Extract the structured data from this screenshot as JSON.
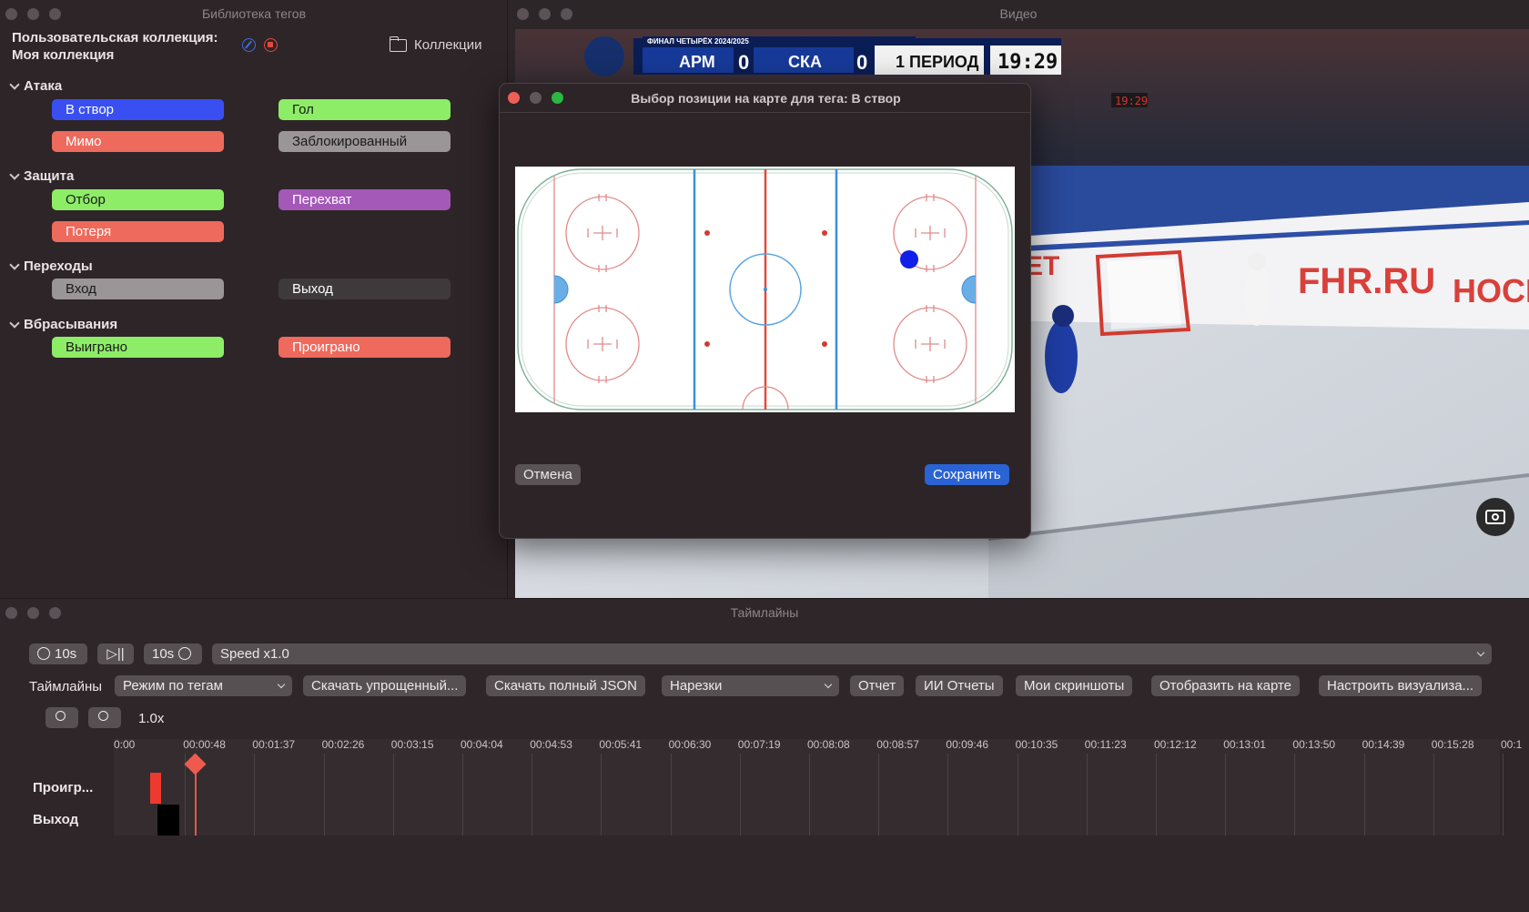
{
  "taglib": {
    "title": "Библиотека тегов",
    "collection_line1": "Пользовательская коллекция:",
    "collection_line2": "Моя коллекция",
    "collections_button": "Коллекции",
    "categories": [
      {
        "name": "Атака",
        "tags": [
          {
            "label": "В створ",
            "color": "#3a4ff2"
          },
          {
            "label": "Гол",
            "color": "#8ded67"
          },
          {
            "label": "Мимо",
            "color": "#ee6a5c"
          },
          {
            "label": "Заблокированный",
            "color": "#9a9597"
          }
        ]
      },
      {
        "name": "Защита",
        "tags": [
          {
            "label": "Отбор",
            "color": "#8ded67"
          },
          {
            "label": "Перехват",
            "color": "#a458b8"
          },
          {
            "label": "Потеря",
            "color": "#ee6a5c"
          }
        ]
      },
      {
        "name": "Переходы",
        "tags": [
          {
            "label": "Вход",
            "color": "#9a9597"
          },
          {
            "label": "Выход",
            "color": "#3e3a3c"
          }
        ]
      },
      {
        "name": "Вбрасывания",
        "tags": [
          {
            "label": "Выиграно",
            "color": "#8ded67"
          },
          {
            "label": "Проиграно",
            "color": "#ee6a5c"
          }
        ]
      }
    ]
  },
  "video": {
    "title": "Видео",
    "scoreboard": {
      "stage": "ФИНАЛ ЧЕТЫРЁХ 2024/2025",
      "team1": "АРМ",
      "score1": "0",
      "team2": "СКА",
      "score2": "0",
      "period": "1 ПЕРИОД",
      "clock": "19:29",
      "arena_clock": "19:29"
    },
    "ad_text1": "FHR.RU",
    "ad_text2": "HOCK",
    "ad_text3": "ЕТ"
  },
  "modal": {
    "title": "Выбор позиции на карте для тега: В створ",
    "cancel": "Отмена",
    "save": "Сохранить",
    "marker_color": "#1020e8"
  },
  "timelines": {
    "title": "Таймлайны",
    "rewind": "10s",
    "forward": "10s",
    "speed": "Speed x1.0",
    "label": "Таймлайны",
    "mode": "Режим по тегам",
    "download_simple": "Скачать упрощенный...",
    "download_full": "Скачать полный JSON",
    "cuts": "Нарезки",
    "report": "Отчет",
    "ai_reports": "ИИ Отчеты",
    "screenshots": "Мои скриншоты",
    "show_on_map": "Отобразить на карте",
    "configure": "Настроить визуализа...",
    "zoom": "1.0x",
    "ticks": [
      "0:00",
      "00:00:48",
      "00:01:37",
      "00:02:26",
      "00:03:15",
      "00:04:04",
      "00:04:53",
      "00:05:41",
      "00:06:30",
      "00:07:19",
      "00:08:08",
      "00:08:57",
      "00:09:46",
      "00:10:35",
      "00:11:23",
      "00:12:12",
      "00:13:01",
      "00:13:50",
      "00:14:39",
      "00:15:28",
      "00:1"
    ],
    "rows": [
      {
        "label": "Проигр...",
        "color": "#ee3a2e"
      },
      {
        "label": "Выход",
        "color": "#000000"
      }
    ]
  }
}
